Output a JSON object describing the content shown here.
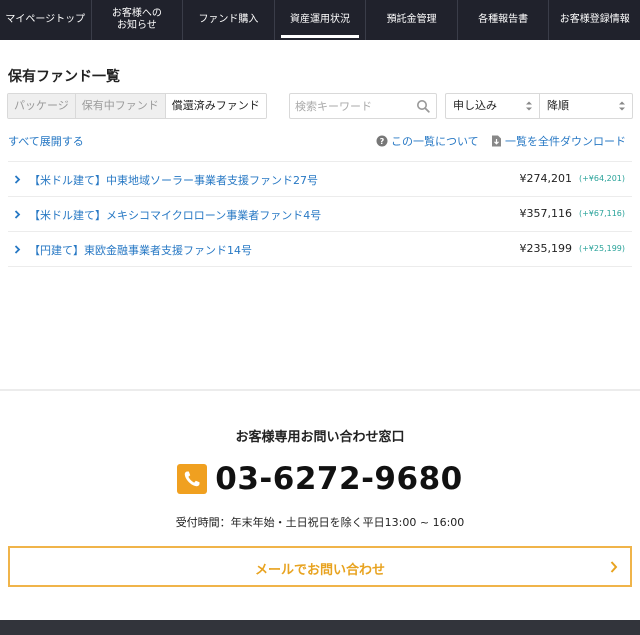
{
  "nav": {
    "items": [
      {
        "label": "マイページトップ",
        "active": false
      },
      {
        "label": "お客様への\nお知らせ",
        "active": false
      },
      {
        "label": "ファンド購入",
        "active": false
      },
      {
        "label": "資産運用状況",
        "active": true
      },
      {
        "label": "預託金管理",
        "active": false
      },
      {
        "label": "各種報告書",
        "active": false
      },
      {
        "label": "お客様登録情報",
        "active": false
      }
    ]
  },
  "main": {
    "title": "保有ファンド一覧",
    "tabs": [
      {
        "label": "パッケージ",
        "active": false
      },
      {
        "label": "保有中ファンド",
        "active": false
      },
      {
        "label": "償還済みファンド",
        "active": true
      }
    ],
    "search": {
      "placeholder": "検索キーワード",
      "value": ""
    },
    "sort_field": "申し込み",
    "sort_order": "降順",
    "expand_all": "すべて展開する",
    "about_link": "この一覧について",
    "download_link": "一覧を全件ダウンロード",
    "funds": [
      {
        "name": "【米ドル建て】中東地域ソーラー事業者支援ファンド27号",
        "amount": "¥274,201",
        "gain": "(+¥64,201)"
      },
      {
        "name": "【米ドル建て】メキシコマイクロローン事業者ファンド4号",
        "amount": "¥357,116",
        "gain": "(+¥67,116)"
      },
      {
        "name": "【円建て】東欧金融事業者支援ファンド14号",
        "amount": "¥235,199",
        "gain": "(+¥25,199)"
      }
    ]
  },
  "contact": {
    "title": "お客様専用お問い合わせ窓口",
    "phone": "03-6272-9680",
    "hours": "受付時間：年末年始・土日祝日を除く平日13:00 ~ 16:00",
    "mail_button": "メールでお問い合わせ"
  },
  "colors": {
    "nav_bg": "#20222c",
    "link": "#2778c4",
    "gain": "#2aa39a",
    "accent": "#f0a020"
  }
}
